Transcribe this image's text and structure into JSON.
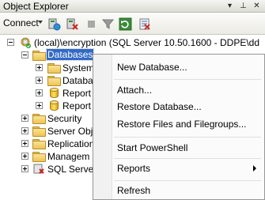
{
  "titlebar": {
    "title": "Object Explorer",
    "pin_glyph": "▾",
    "autohide_glyph": "⊥",
    "close_glyph": "✕"
  },
  "toolbar": {
    "connect_label": "Connect",
    "icons": [
      "connect-server-icon",
      "disconnect-icon",
      "stop-icon",
      "filter-icon",
      "refresh-icon",
      "schema-icon"
    ]
  },
  "tree": {
    "server": "(local)\\encryption (SQL Server 10.50.1600 - DDPE\\dd",
    "databases": "Databases",
    "db_children": [
      "System",
      "Databa",
      "Report",
      "Report"
    ],
    "nodes": [
      "Security",
      "Server Obj",
      "Replication",
      "Managem",
      "SQL Server"
    ]
  },
  "menu": {
    "new_database": "New Database...",
    "attach": "Attach...",
    "restore_database": "Restore Database...",
    "restore_files": "Restore Files and Filegroups...",
    "start_powershell": "Start PowerShell",
    "reports": "Reports",
    "refresh": "Refresh"
  },
  "colors": {
    "selection": "#3169c6",
    "folder": "#eec551"
  }
}
